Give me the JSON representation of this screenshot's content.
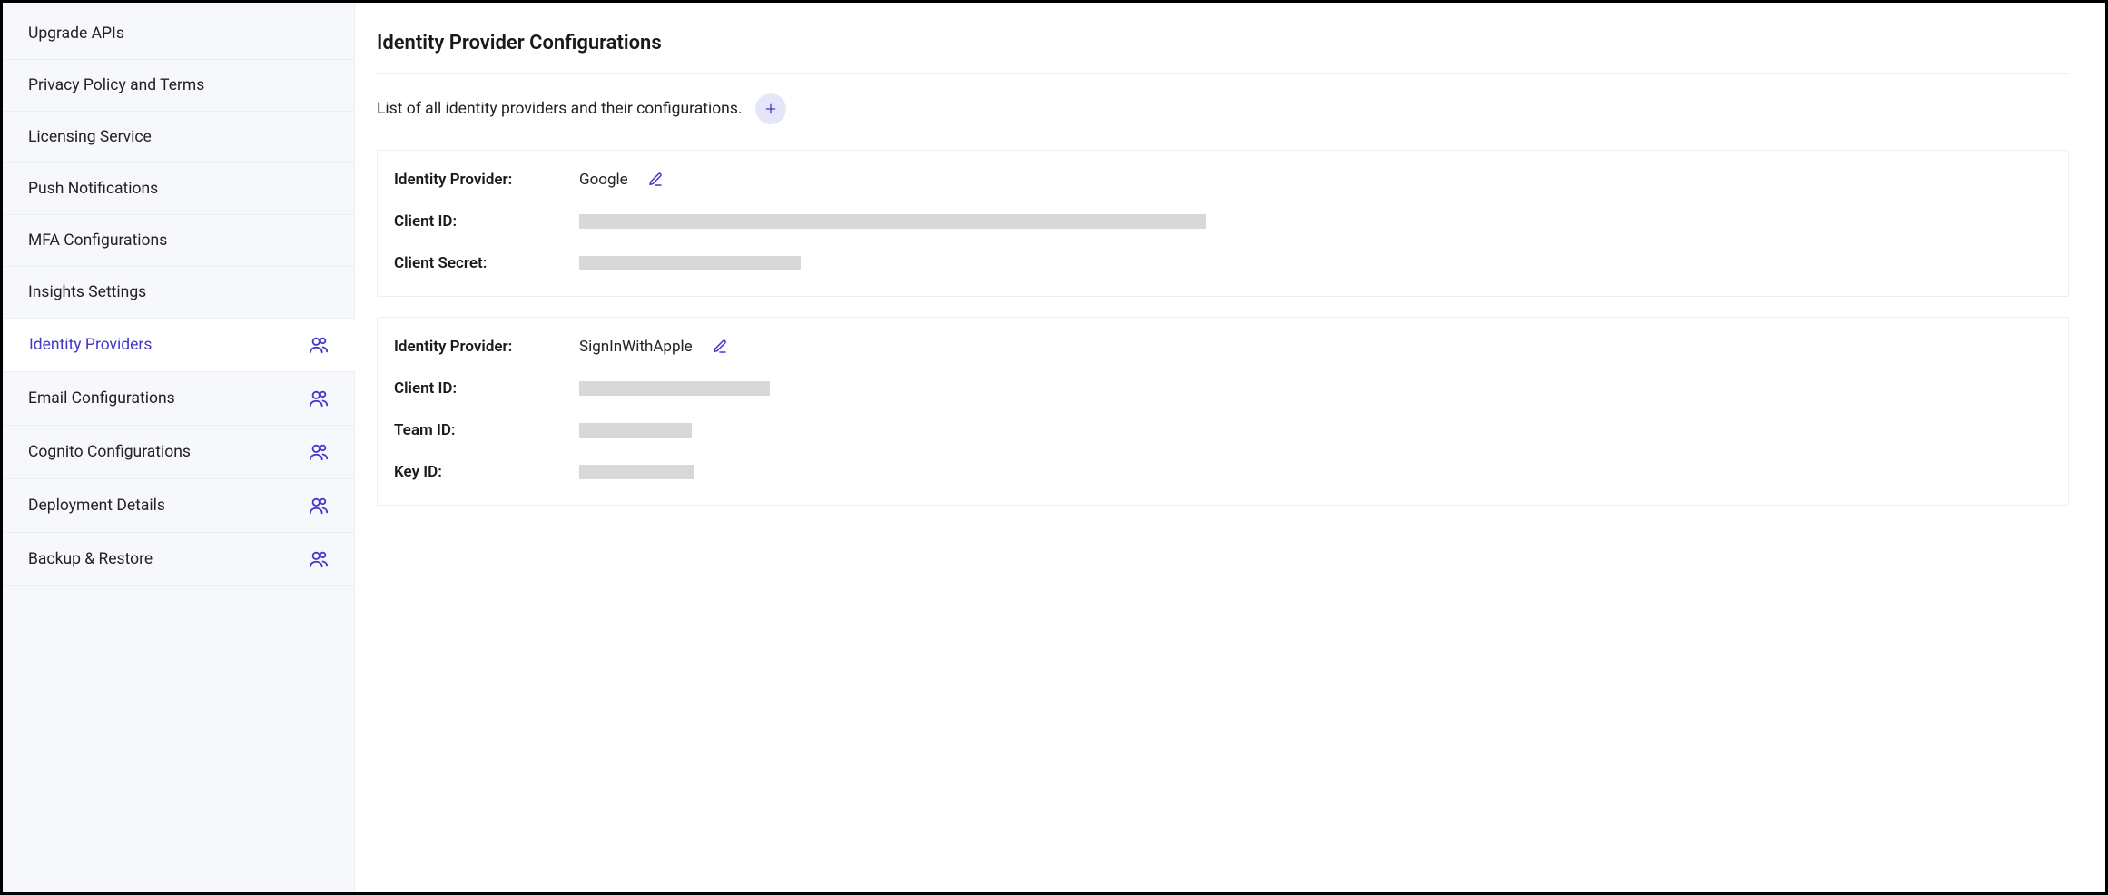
{
  "sidebar": {
    "items": [
      {
        "label": "Upgrade APIs",
        "hasIcon": false,
        "active": false
      },
      {
        "label": "Privacy Policy and Terms",
        "hasIcon": false,
        "active": false
      },
      {
        "label": "Licensing Service",
        "hasIcon": false,
        "active": false
      },
      {
        "label": "Push Notifications",
        "hasIcon": false,
        "active": false
      },
      {
        "label": "MFA Configurations",
        "hasIcon": false,
        "active": false
      },
      {
        "label": "Insights Settings",
        "hasIcon": false,
        "active": false
      },
      {
        "label": "Identity Providers",
        "hasIcon": true,
        "active": true
      },
      {
        "label": "Email Configurations",
        "hasIcon": true,
        "active": false
      },
      {
        "label": "Cognito Configurations",
        "hasIcon": true,
        "active": false
      },
      {
        "label": "Deployment Details",
        "hasIcon": true,
        "active": false
      },
      {
        "label": "Backup & Restore",
        "hasIcon": true,
        "active": false
      }
    ]
  },
  "main": {
    "title": "Identity Provider Configurations",
    "subtitle": "List of all identity providers and their configurations.",
    "providers": [
      {
        "name": "Google",
        "fields": [
          {
            "label": "Identity Provider:",
            "value": "Google",
            "editable": true,
            "redacted": false
          },
          {
            "label": "Client ID:",
            "redacted": true,
            "redactWidth": "w690"
          },
          {
            "label": "Client Secret:",
            "redacted": true,
            "redactWidth": "w244"
          }
        ]
      },
      {
        "name": "SignInWithApple",
        "fields": [
          {
            "label": "Identity Provider:",
            "value": "SignInWithApple",
            "editable": true,
            "redacted": false
          },
          {
            "label": "Client ID:",
            "redacted": true,
            "redactWidth": "w210"
          },
          {
            "label": "Team ID:",
            "redacted": true,
            "redactWidth": "w124"
          },
          {
            "label": "Key ID:",
            "redacted": true,
            "redactWidth": "w126"
          }
        ]
      }
    ]
  }
}
